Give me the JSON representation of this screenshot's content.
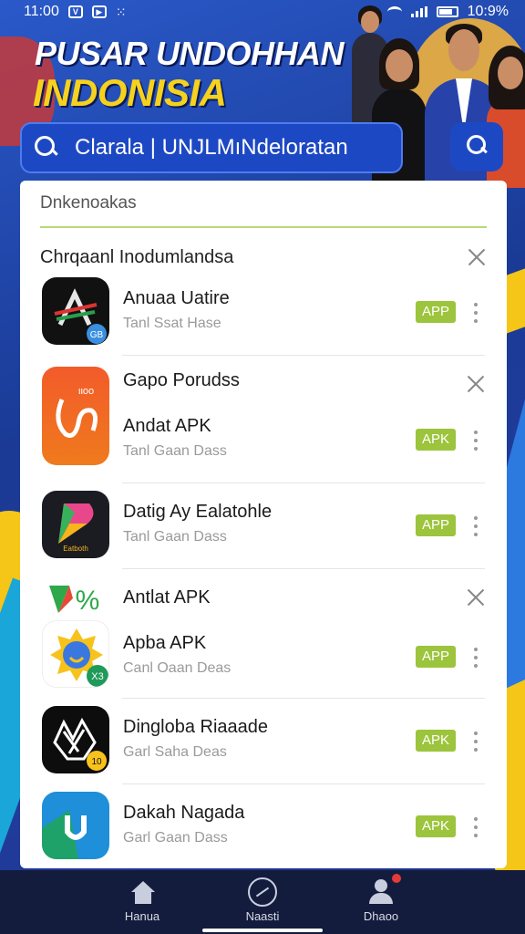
{
  "status_bar": {
    "time": "11:00",
    "right_time": "10:9%"
  },
  "banner": {
    "title_line1": "PUSAR UNDOHHAN",
    "title_line2": "INDONISIA"
  },
  "search": {
    "value": "Clarala | UNJLMıNdeloratan"
  },
  "card": {
    "heading": "Dnkenoakas",
    "section_title": "Chrqaanl Inodumlandsa",
    "items": [
      {
        "name": "Anuaa Uatire",
        "sub": "Tanl Ssat Hase",
        "badge": "APP"
      },
      {
        "name": "Gapo Porudss",
        "sub": "",
        "badge": ""
      },
      {
        "name": "Andat APK",
        "sub": "Tanl Gaan Dass",
        "badge": "APK"
      },
      {
        "name": "Datig Ay Ealatohle",
        "sub": "Tanl Gaan Dass",
        "badge": "APP"
      },
      {
        "name": "Antlat APK",
        "sub": "",
        "badge": ""
      },
      {
        "name": "Apba APK",
        "sub": "Canl Oaan Deas",
        "badge": "APP"
      },
      {
        "name": "Dingloba Riaaade",
        "sub": "Garl Saha Deas",
        "badge": "APK"
      },
      {
        "name": "Dakah Nagada",
        "sub": "Garl Gaan Dass",
        "badge": "APK"
      }
    ]
  },
  "bottom_nav": {
    "items": [
      {
        "label": "Hanua",
        "icon": "home-icon"
      },
      {
        "label": "Naasti",
        "icon": "compass-icon"
      },
      {
        "label": "Dhaoo",
        "icon": "profile-icon"
      }
    ]
  },
  "colors": {
    "accent": "#1d48c4",
    "badge": "#9cc43c",
    "banner_yellow": "#f7d21c",
    "nav_bg": "#141c3e"
  }
}
